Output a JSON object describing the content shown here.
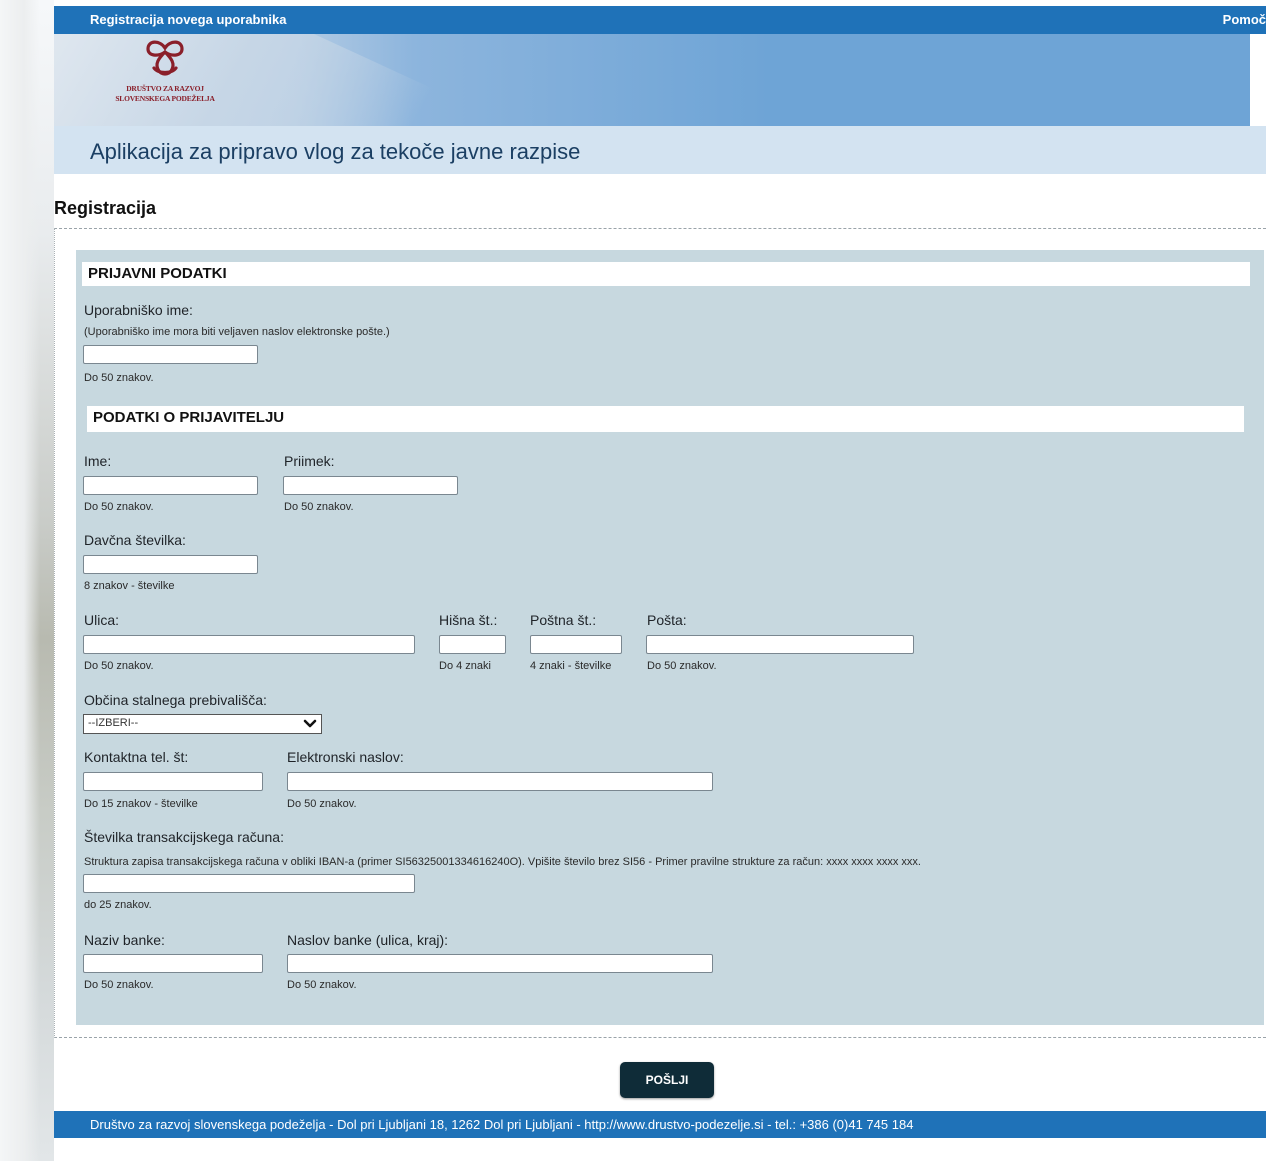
{
  "topbar": {
    "title": "Registracija novega uporabnika",
    "help": "Pomoč"
  },
  "logo": {
    "line1": "DRUŠTVO ZA RAZVOJ",
    "line2": "SLOVENSKEGA PODEŽELJA"
  },
  "app_title": "Aplikacija za pripravo vlog za tekoče javne razpise",
  "page_heading": "Registracija",
  "sections": {
    "login": "PRIJAVNI PODATKI",
    "applicant": "PODATKI O PRIJAVITELJU"
  },
  "fields": {
    "username": {
      "label": "Uporabniško ime:",
      "hint": "(Uporabniško ime mora biti veljaven naslov elektronske pošte.)",
      "note": "Do 50 znakov.",
      "value": ""
    },
    "first_name": {
      "label": "Ime:",
      "note": "Do 50 znakov.",
      "value": ""
    },
    "last_name": {
      "label": "Priimek:",
      "note": "Do 50 znakov.",
      "value": ""
    },
    "tax_number": {
      "label": "Davčna številka:",
      "note": "8 znakov - številke",
      "value": ""
    },
    "street": {
      "label": "Ulica:",
      "note": "Do 50 znakov.",
      "value": ""
    },
    "house_number": {
      "label": "Hišna št.:",
      "note": "Do 4 znaki",
      "value": ""
    },
    "postal_code": {
      "label": "Poštna št.:",
      "note": "4 znaki - številke",
      "value": ""
    },
    "post": {
      "label": "Pošta:",
      "note": "Do 50 znakov.",
      "value": ""
    },
    "municipality": {
      "label": "Občina stalnega prebivališča:",
      "selected": "--IZBERI--"
    },
    "phone": {
      "label": "Kontaktna tel. št:",
      "note": "Do 15 znakov - številke",
      "value": ""
    },
    "email": {
      "label": "Elektronski naslov:",
      "note": "Do 50 znakov.",
      "value": ""
    },
    "account": {
      "label": "Številka transakcijskega računa:",
      "hint": "Struktura zapisa transakcijskega računa v obliki IBAN-a (primer SI56325001334616240O). Vpišite število brez SI56 - Primer pravilne strukture za račun: xxxx xxxx xxxx xxx.",
      "note": "do 25 znakov.",
      "value": ""
    },
    "bank_name": {
      "label": "Naziv banke:",
      "note": "Do 50 znakov.",
      "value": ""
    },
    "bank_address": {
      "label": "Naslov banke (ulica, kraj):",
      "note": "Do 50 znakov.",
      "value": ""
    }
  },
  "submit_label": "POŠLJI",
  "footer": "Društvo za razvoj slovenskega podeželja - Dol pri Ljubljani 18, 1262 Dol pri Ljubljani - http://www.drustvo-podezelje.si - tel.: +386 (0)41 745 184",
  "colors": {
    "bar": "#1f72b8",
    "panel": "#c7d8df",
    "button": "#0f2c38",
    "logo": "#8a1f2a"
  }
}
